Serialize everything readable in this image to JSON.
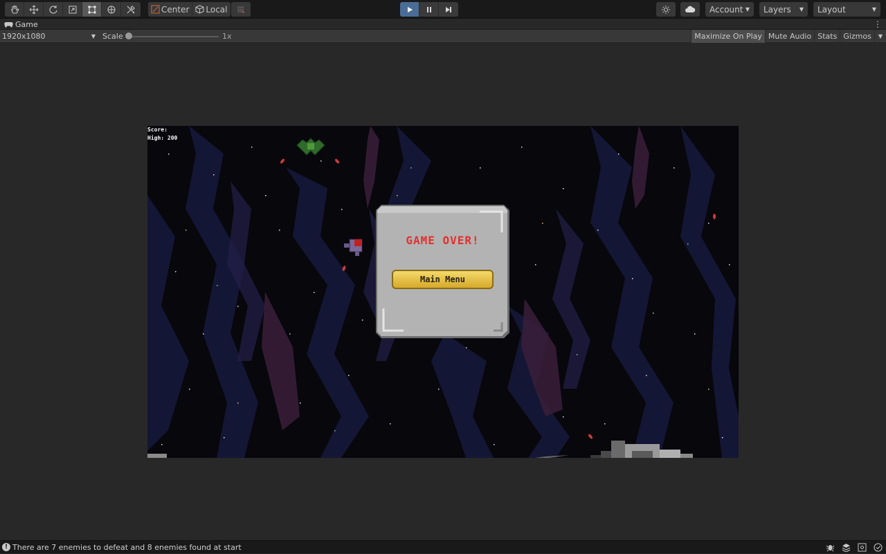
{
  "toolbar": {
    "tools": [
      "hand-tool",
      "move-tool",
      "rotate-tool",
      "scale-tool",
      "rect-tool",
      "transform-tool",
      "custom-tool"
    ],
    "active_tool": "rect-tool",
    "pivot_center_label": "Center",
    "pivot_local_label": "Local",
    "account_label": "Account",
    "layers_label": "Layers",
    "layout_label": "Layout"
  },
  "game_tab": {
    "label": "Game"
  },
  "game_bar": {
    "resolution": "1920x1080",
    "scale_label": "Scale",
    "scale_value": "1x",
    "maximize_label": "Maximize On Play",
    "mute_label": "Mute Audio",
    "stats_label": "Stats",
    "gizmos_label": "Gizmos"
  },
  "game": {
    "score_label": "Score:",
    "high_label": "High: 200",
    "game_over": "GAME OVER!",
    "main_menu": "Main Menu"
  },
  "status": {
    "message": "There are 7 enemies to defeat and 8 enemies found at start"
  },
  "colors": {
    "accent_play": "#4a6d96",
    "game_over_red": "#e0312f",
    "button_gold": "#e8c44a"
  }
}
